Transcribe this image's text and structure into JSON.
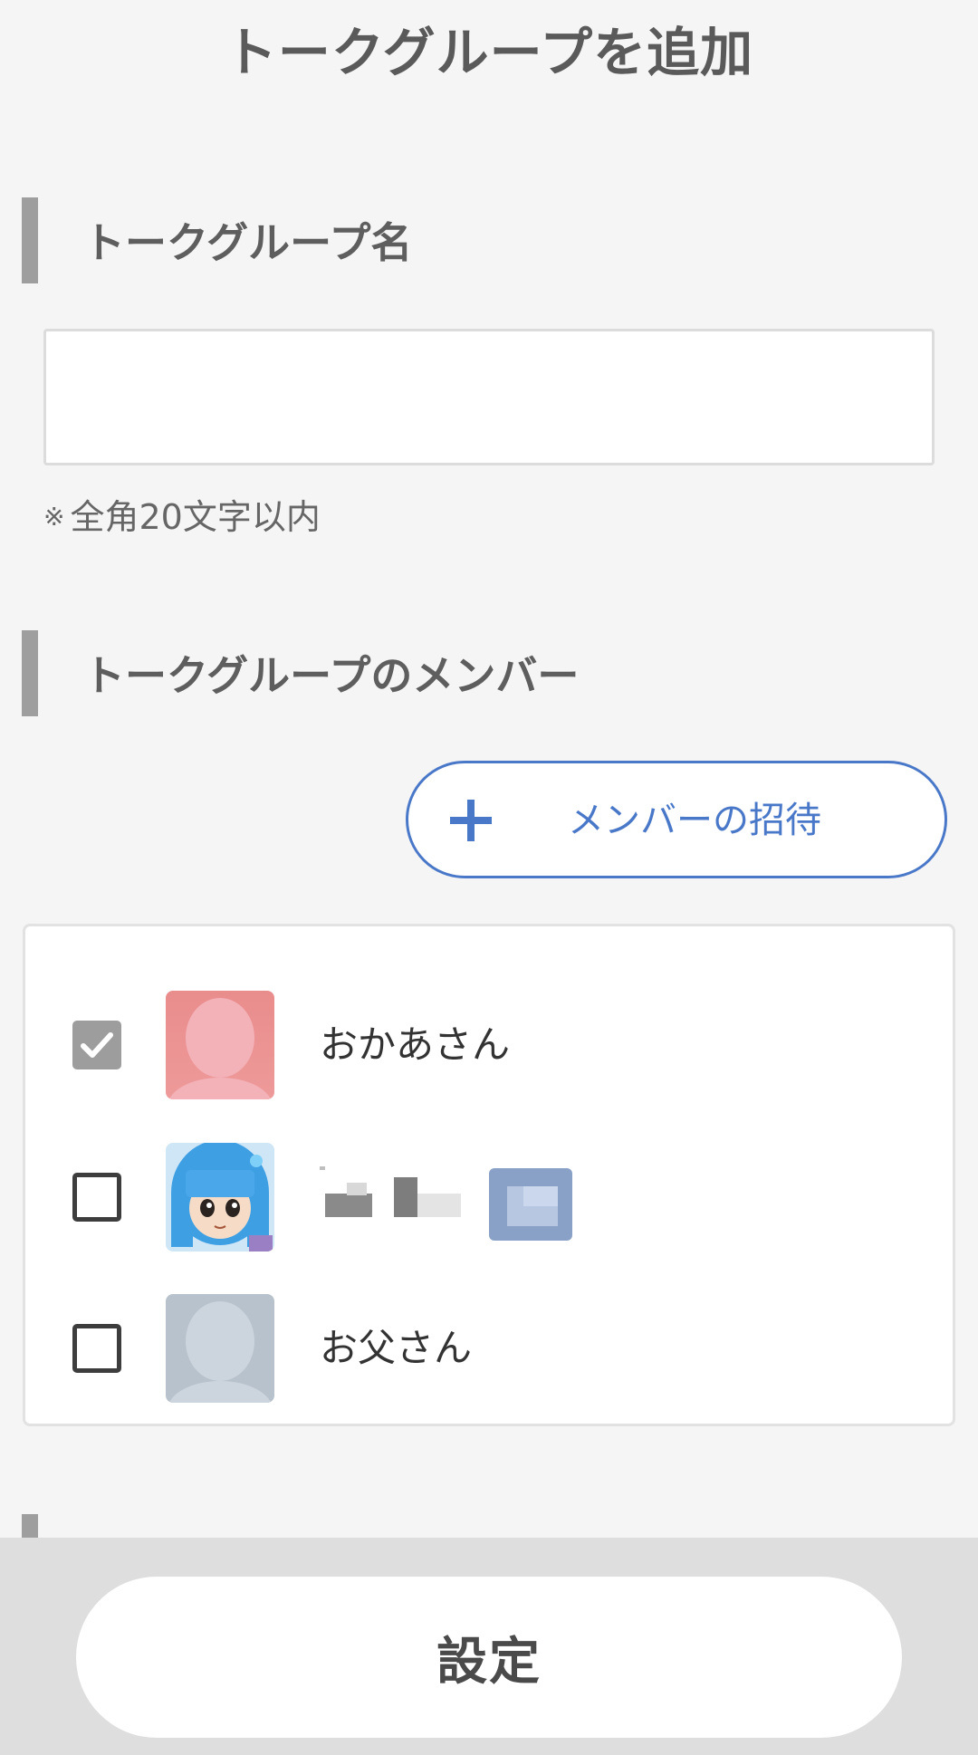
{
  "header": {
    "title": "トークグループを追加"
  },
  "group_name_section": {
    "title": "トークグループ名",
    "input_value": "",
    "hint_mark": "※",
    "hint": "全角20文字以内"
  },
  "members_section": {
    "title": "トークグループのメンバー",
    "invite_button_label": "メンバーの招待",
    "members": [
      {
        "name": "おかあさん",
        "checked": true,
        "avatar": "pink-default-avatar"
      },
      {
        "name": "",
        "checked": false,
        "avatar": "blue-hair-character-avatar",
        "name_obscured": true
      },
      {
        "name": "お父さん",
        "checked": false,
        "avatar": "gray-default-avatar"
      }
    ]
  },
  "footer": {
    "submit_label": "設定"
  },
  "colors": {
    "background": "#f5f5f5",
    "accent_blue": "#4a78c9",
    "section_bar": "#9e9e9e",
    "footer_bg": "#dedede"
  }
}
